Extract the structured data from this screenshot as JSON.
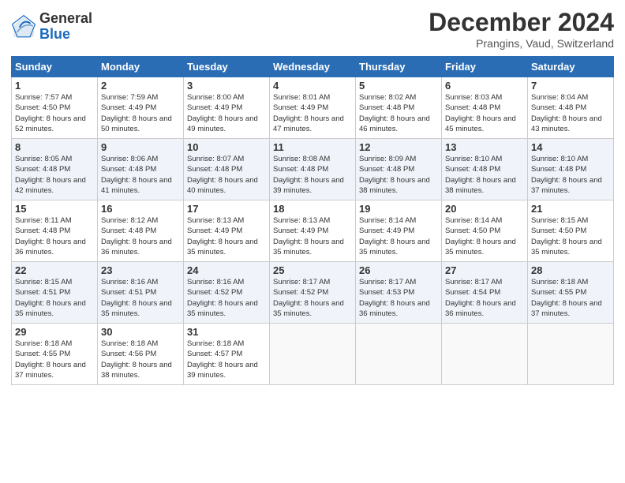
{
  "header": {
    "logo_general": "General",
    "logo_blue": "Blue",
    "month_title": "December 2024",
    "location": "Prangins, Vaud, Switzerland"
  },
  "days_of_week": [
    "Sunday",
    "Monday",
    "Tuesday",
    "Wednesday",
    "Thursday",
    "Friday",
    "Saturday"
  ],
  "weeks": [
    [
      {
        "day": "1",
        "rise": "7:57 AM",
        "set": "4:50 PM",
        "daylight": "8 hours and 52 minutes."
      },
      {
        "day": "2",
        "rise": "7:59 AM",
        "set": "4:49 PM",
        "daylight": "8 hours and 50 minutes."
      },
      {
        "day": "3",
        "rise": "8:00 AM",
        "set": "4:49 PM",
        "daylight": "8 hours and 49 minutes."
      },
      {
        "day": "4",
        "rise": "8:01 AM",
        "set": "4:49 PM",
        "daylight": "8 hours and 47 minutes."
      },
      {
        "day": "5",
        "rise": "8:02 AM",
        "set": "4:48 PM",
        "daylight": "8 hours and 46 minutes."
      },
      {
        "day": "6",
        "rise": "8:03 AM",
        "set": "4:48 PM",
        "daylight": "8 hours and 45 minutes."
      },
      {
        "day": "7",
        "rise": "8:04 AM",
        "set": "4:48 PM",
        "daylight": "8 hours and 43 minutes."
      }
    ],
    [
      {
        "day": "8",
        "rise": "8:05 AM",
        "set": "4:48 PM",
        "daylight": "8 hours and 42 minutes."
      },
      {
        "day": "9",
        "rise": "8:06 AM",
        "set": "4:48 PM",
        "daylight": "8 hours and 41 minutes."
      },
      {
        "day": "10",
        "rise": "8:07 AM",
        "set": "4:48 PM",
        "daylight": "8 hours and 40 minutes."
      },
      {
        "day": "11",
        "rise": "8:08 AM",
        "set": "4:48 PM",
        "daylight": "8 hours and 39 minutes."
      },
      {
        "day": "12",
        "rise": "8:09 AM",
        "set": "4:48 PM",
        "daylight": "8 hours and 38 minutes."
      },
      {
        "day": "13",
        "rise": "8:10 AM",
        "set": "4:48 PM",
        "daylight": "8 hours and 38 minutes."
      },
      {
        "day": "14",
        "rise": "8:10 AM",
        "set": "4:48 PM",
        "daylight": "8 hours and 37 minutes."
      }
    ],
    [
      {
        "day": "15",
        "rise": "8:11 AM",
        "set": "4:48 PM",
        "daylight": "8 hours and 36 minutes."
      },
      {
        "day": "16",
        "rise": "8:12 AM",
        "set": "4:48 PM",
        "daylight": "8 hours and 36 minutes."
      },
      {
        "day": "17",
        "rise": "8:13 AM",
        "set": "4:49 PM",
        "daylight": "8 hours and 35 minutes."
      },
      {
        "day": "18",
        "rise": "8:13 AM",
        "set": "4:49 PM",
        "daylight": "8 hours and 35 minutes."
      },
      {
        "day": "19",
        "rise": "8:14 AM",
        "set": "4:49 PM",
        "daylight": "8 hours and 35 minutes."
      },
      {
        "day": "20",
        "rise": "8:14 AM",
        "set": "4:50 PM",
        "daylight": "8 hours and 35 minutes."
      },
      {
        "day": "21",
        "rise": "8:15 AM",
        "set": "4:50 PM",
        "daylight": "8 hours and 35 minutes."
      }
    ],
    [
      {
        "day": "22",
        "rise": "8:15 AM",
        "set": "4:51 PM",
        "daylight": "8 hours and 35 minutes."
      },
      {
        "day": "23",
        "rise": "8:16 AM",
        "set": "4:51 PM",
        "daylight": "8 hours and 35 minutes."
      },
      {
        "day": "24",
        "rise": "8:16 AM",
        "set": "4:52 PM",
        "daylight": "8 hours and 35 minutes."
      },
      {
        "day": "25",
        "rise": "8:17 AM",
        "set": "4:52 PM",
        "daylight": "8 hours and 35 minutes."
      },
      {
        "day": "26",
        "rise": "8:17 AM",
        "set": "4:53 PM",
        "daylight": "8 hours and 36 minutes."
      },
      {
        "day": "27",
        "rise": "8:17 AM",
        "set": "4:54 PM",
        "daylight": "8 hours and 36 minutes."
      },
      {
        "day": "28",
        "rise": "8:18 AM",
        "set": "4:55 PM",
        "daylight": "8 hours and 37 minutes."
      }
    ],
    [
      {
        "day": "29",
        "rise": "8:18 AM",
        "set": "4:55 PM",
        "daylight": "8 hours and 37 minutes."
      },
      {
        "day": "30",
        "rise": "8:18 AM",
        "set": "4:56 PM",
        "daylight": "8 hours and 38 minutes."
      },
      {
        "day": "31",
        "rise": "8:18 AM",
        "set": "4:57 PM",
        "daylight": "8 hours and 39 minutes."
      },
      null,
      null,
      null,
      null
    ]
  ]
}
